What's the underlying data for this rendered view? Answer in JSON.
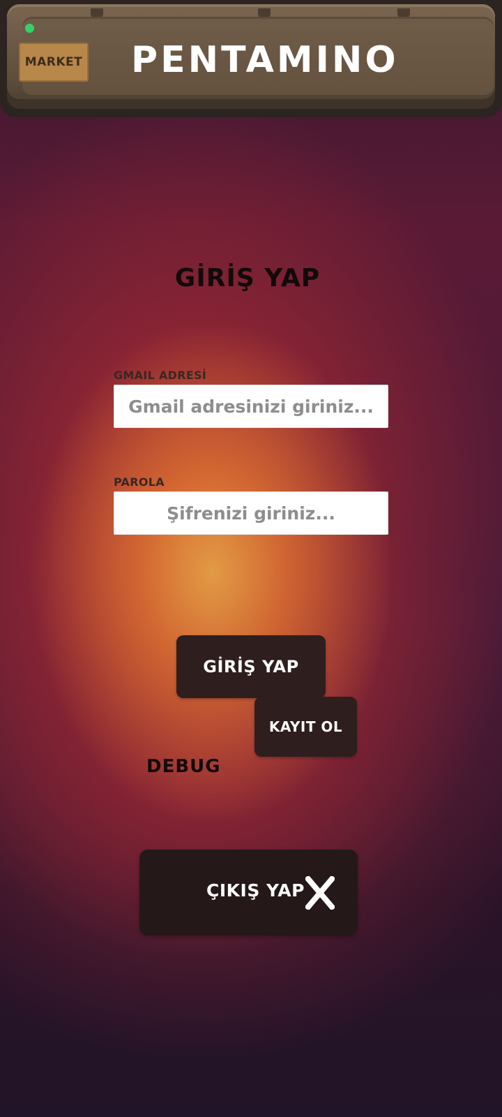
{
  "header": {
    "title": "PENTAMINO",
    "market_label": "MARKET",
    "status_color": "#2fd36a"
  },
  "login": {
    "title": "GİRİŞ YAP",
    "email": {
      "label": "GMAIL ADRESİ",
      "placeholder": "Gmail adresinizi giriniz..."
    },
    "password": {
      "label": "PAROLA",
      "placeholder": "Şifrenizi giriniz..."
    },
    "login_button": "GİRİŞ YAP",
    "register_button": "KAYIT OL",
    "debug_label": "DEBUG",
    "logout_button": "ÇIKIŞ YAP",
    "logout_icon": "close-icon"
  },
  "colors": {
    "button_dark": "#2e1e1e",
    "market_button": "#b8874a",
    "header_wood": "#6d5a46"
  }
}
